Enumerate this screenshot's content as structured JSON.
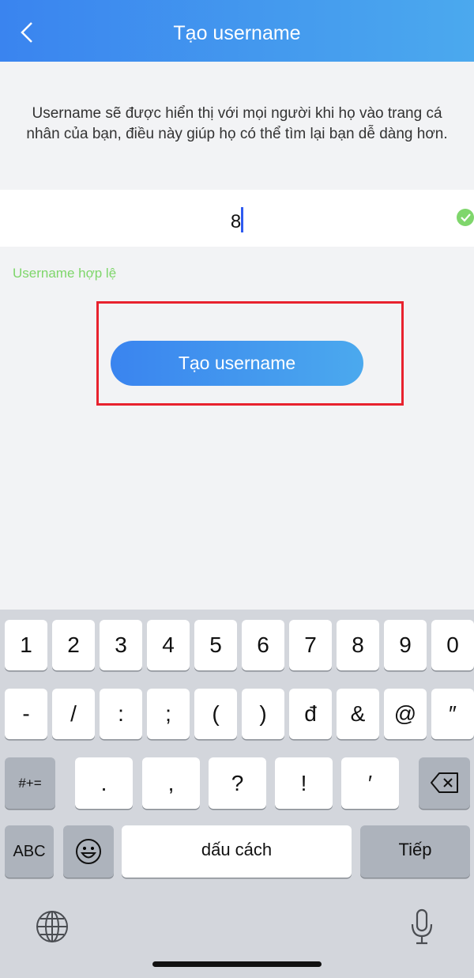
{
  "header": {
    "title": "Tạo username",
    "back_icon": "chevron-left-icon"
  },
  "description": "Username sẽ được hiển thị với mọi người khi họ vào trang cá nhân của bạn, điều này giúp họ có thể tìm lại bạn dễ dàng hơn.",
  "input": {
    "value": "8",
    "status_icon": "check-circle-icon"
  },
  "validation": "Username hợp lệ",
  "submit_label": "Tạo username",
  "colors": {
    "accent": "#3a84ef",
    "valid": "#7ed66a",
    "highlight": "#e8222e"
  },
  "keyboard": {
    "row1": [
      "1",
      "2",
      "3",
      "4",
      "5",
      "6",
      "7",
      "8",
      "9",
      "0"
    ],
    "row2": [
      "-",
      "/",
      ":",
      ";",
      "(",
      ")",
      "đ",
      "&",
      "@",
      "″"
    ],
    "row3": [
      ".",
      ",",
      "?",
      "!",
      "′"
    ],
    "symbols": "#+=",
    "abc": "ABC",
    "space": "dấu cách",
    "next": "Tiếp"
  }
}
